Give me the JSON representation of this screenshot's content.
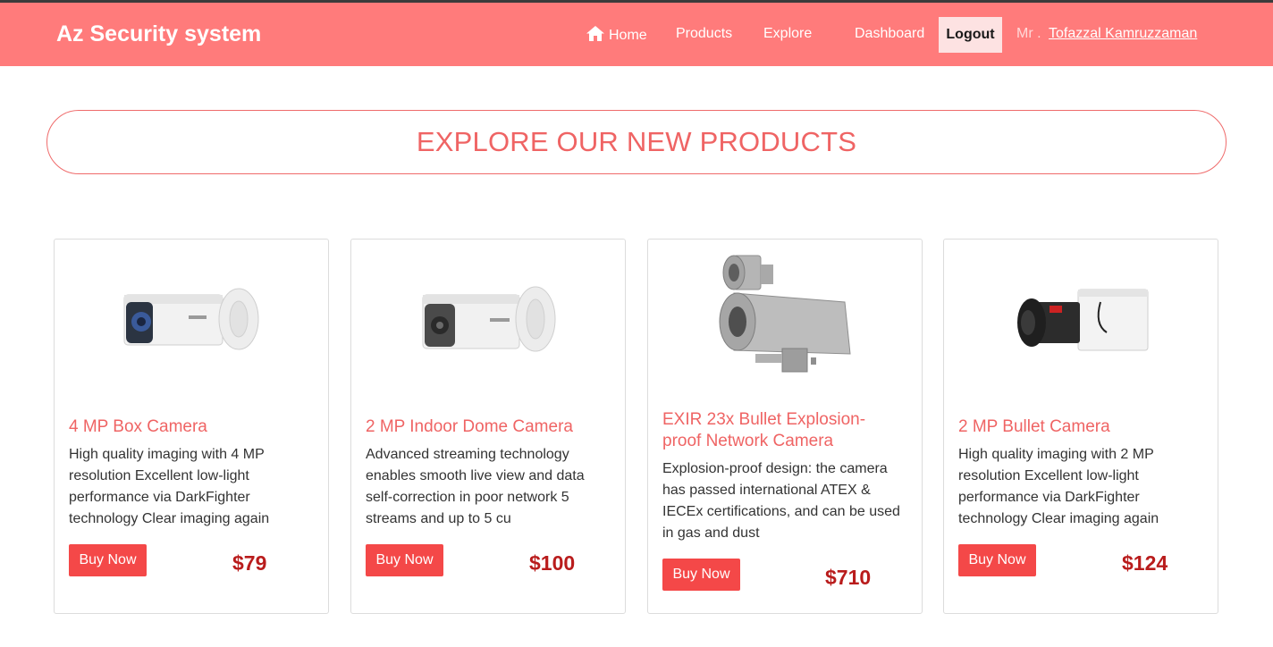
{
  "header": {
    "brand": "Az Security system",
    "nav": {
      "home": "Home",
      "products": "Products",
      "explore": "Explore",
      "dashboard": "Dashboard"
    },
    "logout_label": "Logout",
    "user_prefix": "Mr .",
    "user_name": "Tofazzal Kamruzzaman",
    "icons": {
      "home": "home-icon"
    }
  },
  "banner": {
    "title": "EXPLORE OUR NEW PRODUCTS"
  },
  "colors": {
    "navbar": "#ff7b7b",
    "accent": "#ef6464",
    "button": "#f44848",
    "price": "#b91c1c"
  },
  "products": [
    {
      "title": "4 MP Box Camera",
      "description": "High quality imaging with 4 MP resolution Excellent low-light performance via DarkFighter technology Clear imaging again",
      "buy_label": "Buy Now",
      "price": "$79"
    },
    {
      "title": "2 MP Indoor Dome Camera",
      "description": "Advanced streaming technology enables smooth live view and data self-correction in poor network 5 streams and up to 5 cu",
      "buy_label": "Buy Now",
      "price": "$100"
    },
    {
      "title": "EXIR 23x Bullet Explosion-proof Network Camera",
      "description": "Explosion-proof design: the camera has passed international ATEX & IECEx certifications, and can be used in gas and dust",
      "buy_label": "Buy Now",
      "price": "$710"
    },
    {
      "title": "2 MP Bullet Camera",
      "description": "High quality imaging with 2 MP resolution Excellent low-light performance via DarkFighter technology Clear imaging again",
      "buy_label": "Buy Now",
      "price": "$124"
    }
  ]
}
